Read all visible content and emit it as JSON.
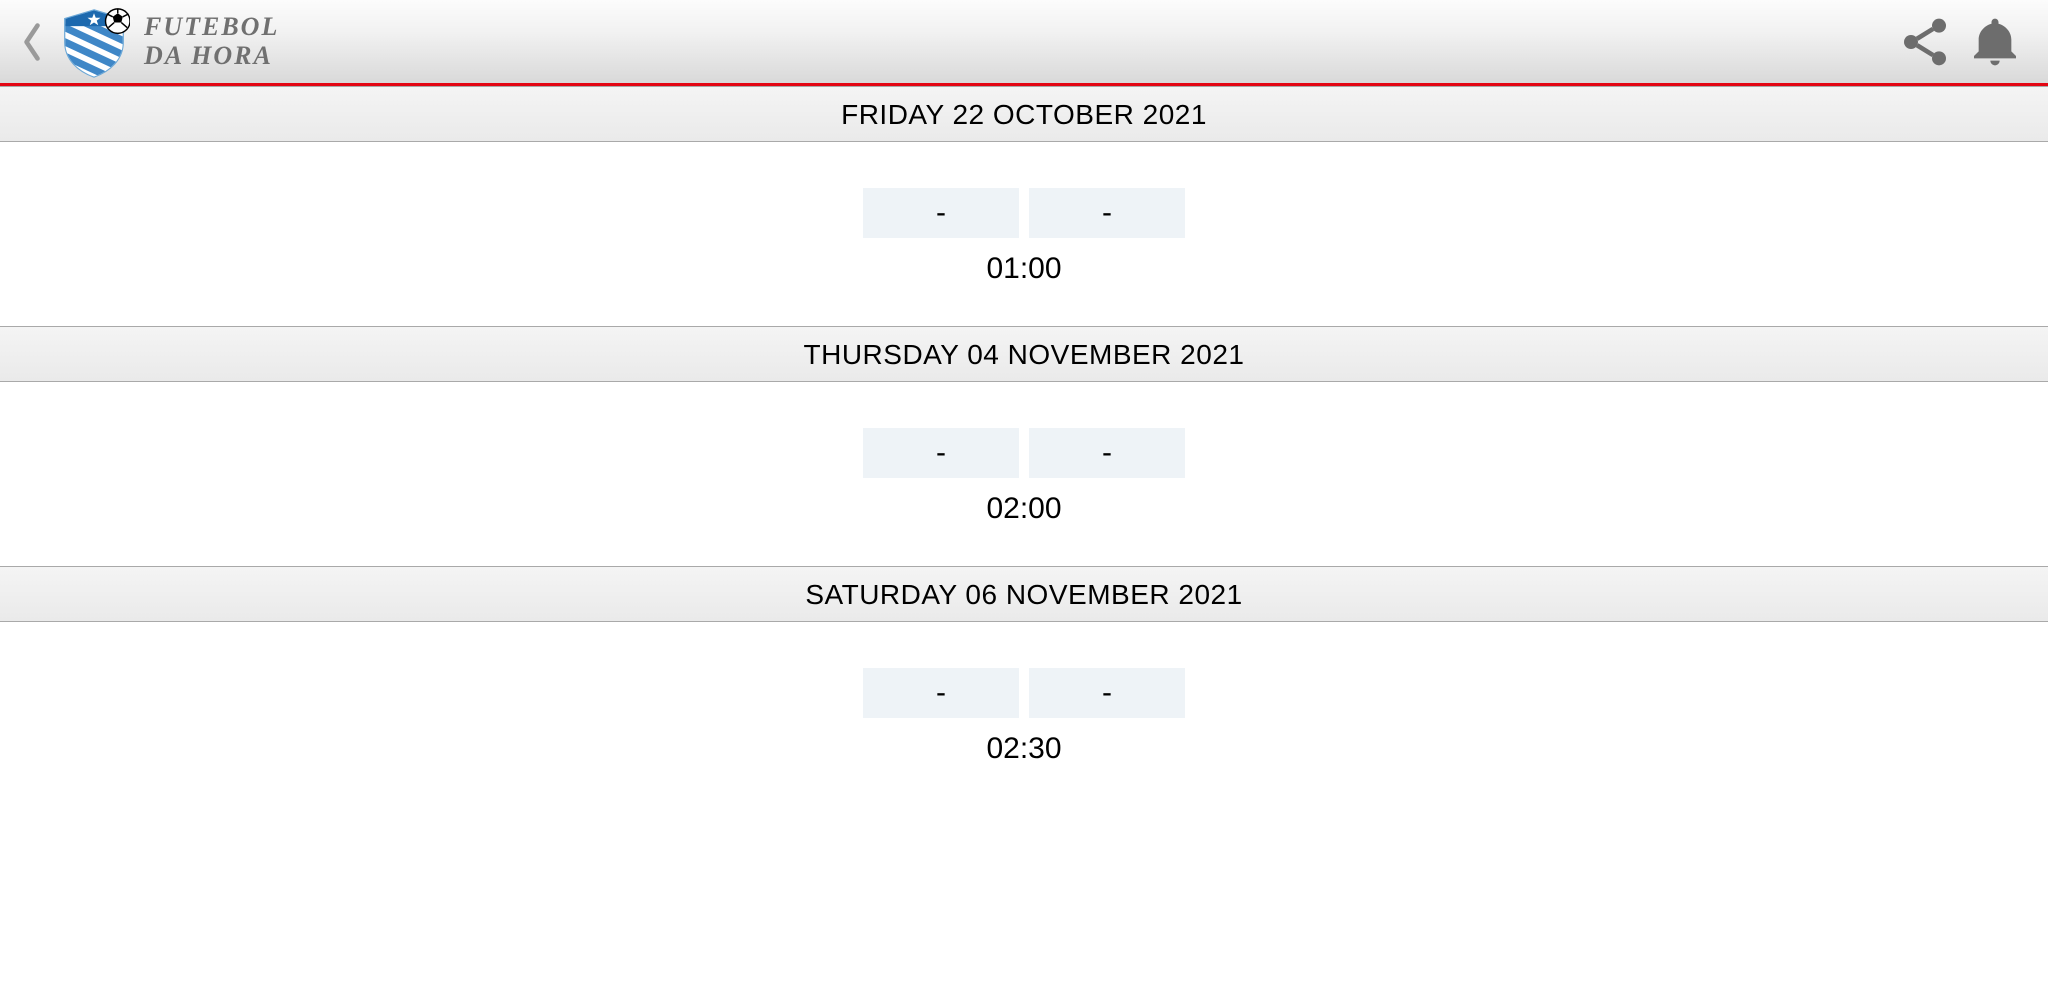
{
  "header": {
    "title_line1": "FUTEBOL",
    "title_line2": "DA HORA"
  },
  "sections": [
    {
      "date": "FRIDAY 22 OCTOBER 2021",
      "matches": [
        {
          "home_score": "-",
          "away_score": "-",
          "time": "01:00"
        }
      ]
    },
    {
      "date": "THURSDAY 04 NOVEMBER 2021",
      "matches": [
        {
          "home_score": "-",
          "away_score": "-",
          "time": "02:00"
        }
      ]
    },
    {
      "date": "SATURDAY 06 NOVEMBER 2021",
      "matches": [
        {
          "home_score": "-",
          "away_score": "-",
          "time": "02:30"
        }
      ]
    }
  ]
}
